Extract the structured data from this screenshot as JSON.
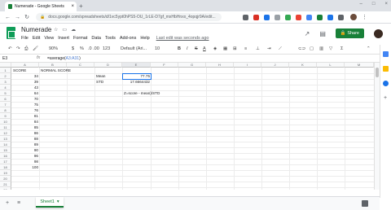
{
  "browser": {
    "tab_title": "Numerade - Google Sheets",
    "tab_close": "×",
    "new_tab": "+",
    "window_controls": [
      "–",
      "□",
      "×"
    ],
    "url": "docs.google.com/spreadsheets/d/1vc5ypt0hPS5-OU_1rLE-D7gf_mxHbHnxx_4opqjr9A/edit..."
  },
  "app": {
    "doc_title": "Numerade",
    "menus": [
      "File",
      "Edit",
      "View",
      "Insert",
      "Format",
      "Data",
      "Tools",
      "Add-ons",
      "Help"
    ],
    "last_edit": "Last edit was seconds ago",
    "share_label": "Share"
  },
  "toolbar": {
    "zoom": "90%",
    "currency": "$",
    "percent": "%",
    "decimals": ".0  .00",
    "number_format": "123",
    "font": "Default (Ari...",
    "font_size": "10",
    "bold": "B",
    "italic": "I",
    "strike": "S",
    "text_color": "A"
  },
  "formula_bar": {
    "name_box": "E3",
    "fx": "fx",
    "formula_prefix": "=average(",
    "formula_ref": "A3:A31",
    "formula_suffix": ")"
  },
  "columns": [
    "A",
    "B",
    "C",
    "D",
    "E",
    "F",
    "G",
    "H",
    "I",
    "J",
    "K",
    "L",
    "M"
  ],
  "rows": [
    "1",
    "2",
    "3",
    "4",
    "5",
    "6",
    "7",
    "8",
    "9",
    "10",
    "11",
    "12",
    "13",
    "14",
    "15",
    "16",
    "17",
    "18",
    "19",
    "20",
    "21",
    "22"
  ],
  "sheet": {
    "header_a": "SCORE",
    "header_b": "NORMAL SCORE",
    "scores": [
      "34",
      "39",
      "43",
      "64",
      "70",
      "75",
      "76",
      "81",
      "84",
      "85",
      "86",
      "88",
      "89",
      "90",
      "96",
      "98",
      "100"
    ],
    "mean_label": "Mean",
    "mean_value": "77.75",
    "std_label": "STD",
    "std_value": "17.6664432",
    "zscore_note": "Z=score - mean)/STD"
  },
  "bottom": {
    "add_sheet": "+",
    "all_sheets": "≡",
    "sheet_tab": "Sheet1",
    "sheet_tab_arrow": "▾"
  },
  "colors": {
    "brand_green": "#188038",
    "selection_blue": "#1a73e8"
  }
}
